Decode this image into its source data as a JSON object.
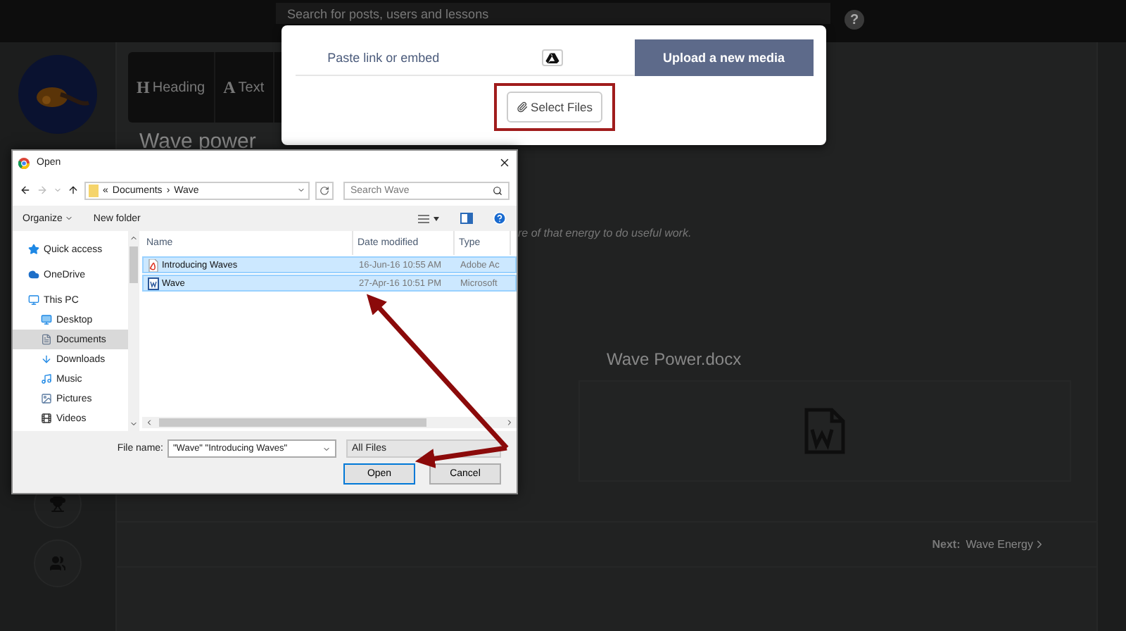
{
  "top_bar": {
    "search": {
      "placeholder": "Search for posts, users and lessons"
    },
    "help": "?"
  },
  "editor_toolbar": [
    {
      "glyph": "H",
      "label": "Heading"
    },
    {
      "glyph": "A",
      "label": "Text"
    }
  ],
  "lesson": {
    "title": "Wave power",
    "body": "re of that energy to do useful work.",
    "attachment": {
      "name": "Wave Power.docx"
    },
    "next": {
      "label": "Next:",
      "target": "Wave Energy"
    }
  },
  "media_modal": {
    "tabs": [
      {
        "kind": "text",
        "label": "Paste link or embed",
        "selected": false
      },
      {
        "kind": "drive",
        "selected": false
      },
      {
        "kind": "text",
        "label": "Upload a new media",
        "selected": true
      }
    ],
    "select_button": "Select Files"
  },
  "open_dialog": {
    "title": "Open",
    "address": [
      "«",
      "Documents",
      "›",
      "Wave"
    ],
    "search": {
      "placeholder": "Search Wave"
    },
    "toolbar": {
      "organize": "Organize",
      "new_folder": "New folder"
    },
    "nav": [
      {
        "label": "Quick access",
        "selected": false
      },
      {
        "label": "OneDrive",
        "selected": false
      },
      {
        "label": "This PC",
        "selected": false,
        "children": [
          {
            "label": "Desktop",
            "selected": false
          },
          {
            "label": "Documents",
            "selected": true
          },
          {
            "label": "Downloads",
            "selected": false
          },
          {
            "label": "Music",
            "selected": false
          },
          {
            "label": "Pictures",
            "selected": false
          },
          {
            "label": "Videos",
            "selected": false
          }
        ]
      }
    ],
    "columns": [
      "Name",
      "Date modified",
      "Type"
    ],
    "files": [
      {
        "kind": "pdf",
        "name": "Introducing Waves",
        "date": "16-Jun-16 10:55 AM",
        "type": "Adobe Ac",
        "selected": true
      },
      {
        "kind": "word",
        "name": "Wave",
        "date": "27-Apr-16 10:51 PM",
        "type": "Microsoft",
        "selected": true
      }
    ],
    "file_name": {
      "label": "File name:",
      "value": "\"Wave\" \"Introducing Waves\""
    },
    "file_type": "All Files",
    "buttons": [
      {
        "kind": "primary",
        "label": "Open"
      },
      {
        "kind": "secondary",
        "label": "Cancel"
      }
    ]
  }
}
